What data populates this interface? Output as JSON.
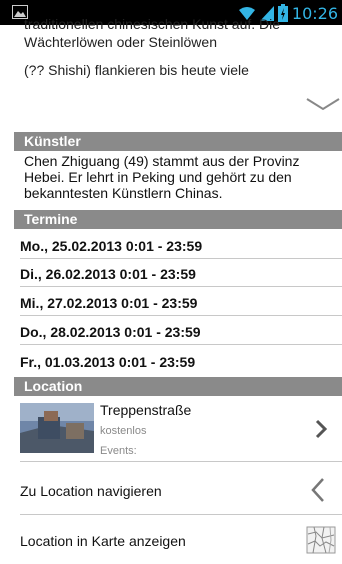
{
  "status_bar": {
    "time": "10:26"
  },
  "description": {
    "cut_line": "traditionellen chinesischen Kunst auf. Die",
    "line1": "Wächterlöwen oder Steinlöwen",
    "line2": "(?? Shishi) flankieren bis heute viele"
  },
  "artist": {
    "header": "Künstler",
    "text": "Chen Zhiguang (49) stammt aus der Provinz Hebei. Er lehrt in Peking und gehört zu den bekanntesten Künstlern Chinas."
  },
  "dates": {
    "header": "Termine",
    "items": [
      "Mo., 25.02.2013 0:01 - 23:59",
      "Di., 26.02.2013 0:01 - 23:59",
      "Mi., 27.02.2013 0:01 - 23:59",
      "Do., 28.02.2013 0:01 - 23:59",
      "Fr., 01.03.2013 0:01 - 23:59"
    ]
  },
  "location": {
    "header": "Location",
    "name": "Treppenstraße",
    "price": "kostenlos",
    "events": "Events:",
    "navigate_label": "Zu Location navigieren",
    "map_label": "Location in Karte anzeigen"
  },
  "colors": {
    "section_header_bg": "#8a8a8a",
    "status_accent": "#33b5e5"
  },
  "icons": [
    "image-icon",
    "wifi-icon",
    "signal-icon",
    "battery-icon",
    "expand-chevron-icon",
    "chevron-right-icon",
    "navigate-arrow-icon",
    "map-icon"
  ]
}
